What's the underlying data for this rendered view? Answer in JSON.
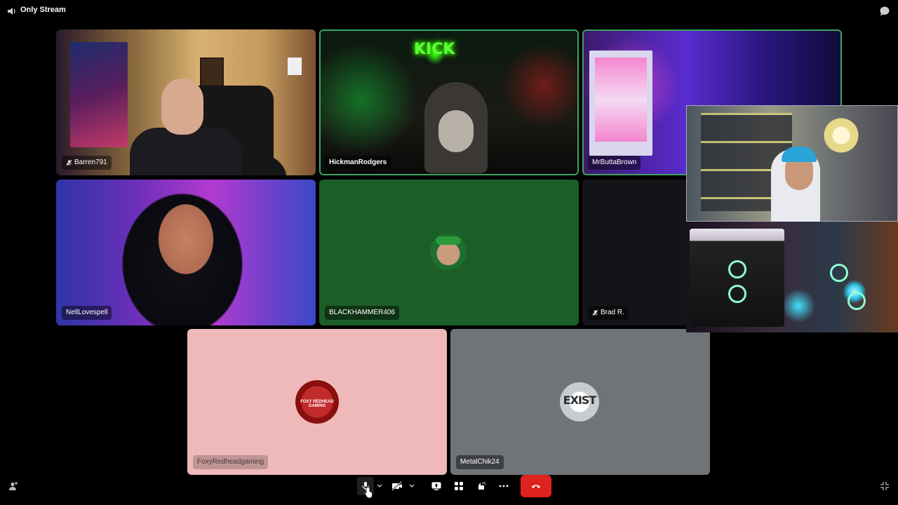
{
  "window": {
    "title": "Only Stream"
  },
  "participants": [
    {
      "name": "Barren791",
      "muted": true,
      "state": "video"
    },
    {
      "name": "HickmanRodgers",
      "muted": false,
      "state": "video",
      "speaking": true
    },
    {
      "name": "MrButtaBrown",
      "muted": false,
      "state": "video",
      "speaking": true
    },
    {
      "name": "NellLovespell",
      "muted": false,
      "state": "video"
    },
    {
      "name": "BLACKHAMMER406",
      "muted": false,
      "state": "avatar",
      "background": "#1c5e27"
    },
    {
      "name": "Brad R.",
      "muted": true,
      "state": "video"
    },
    {
      "name": "FoxyRedheadgaming",
      "muted": false,
      "state": "avatar",
      "background": "#efb9b9",
      "avatar_text": "FOXY REDHEAD GAMING"
    },
    {
      "name": "MetalChik24",
      "muted": false,
      "state": "avatar",
      "background": "#6f7479",
      "avatar_text": "EXIST"
    }
  ],
  "controls": {
    "mic": "microphone-icon",
    "camera": "camera-off-icon",
    "screenshare": "screen-share-icon",
    "activities": "activities-icon",
    "soundboard": "soundboard-icon",
    "more": "more-icon",
    "end_call": "phone-hangup-icon",
    "end_call_color": "#e0221f"
  },
  "colors": {
    "speaking_border": "#3ba55d"
  }
}
